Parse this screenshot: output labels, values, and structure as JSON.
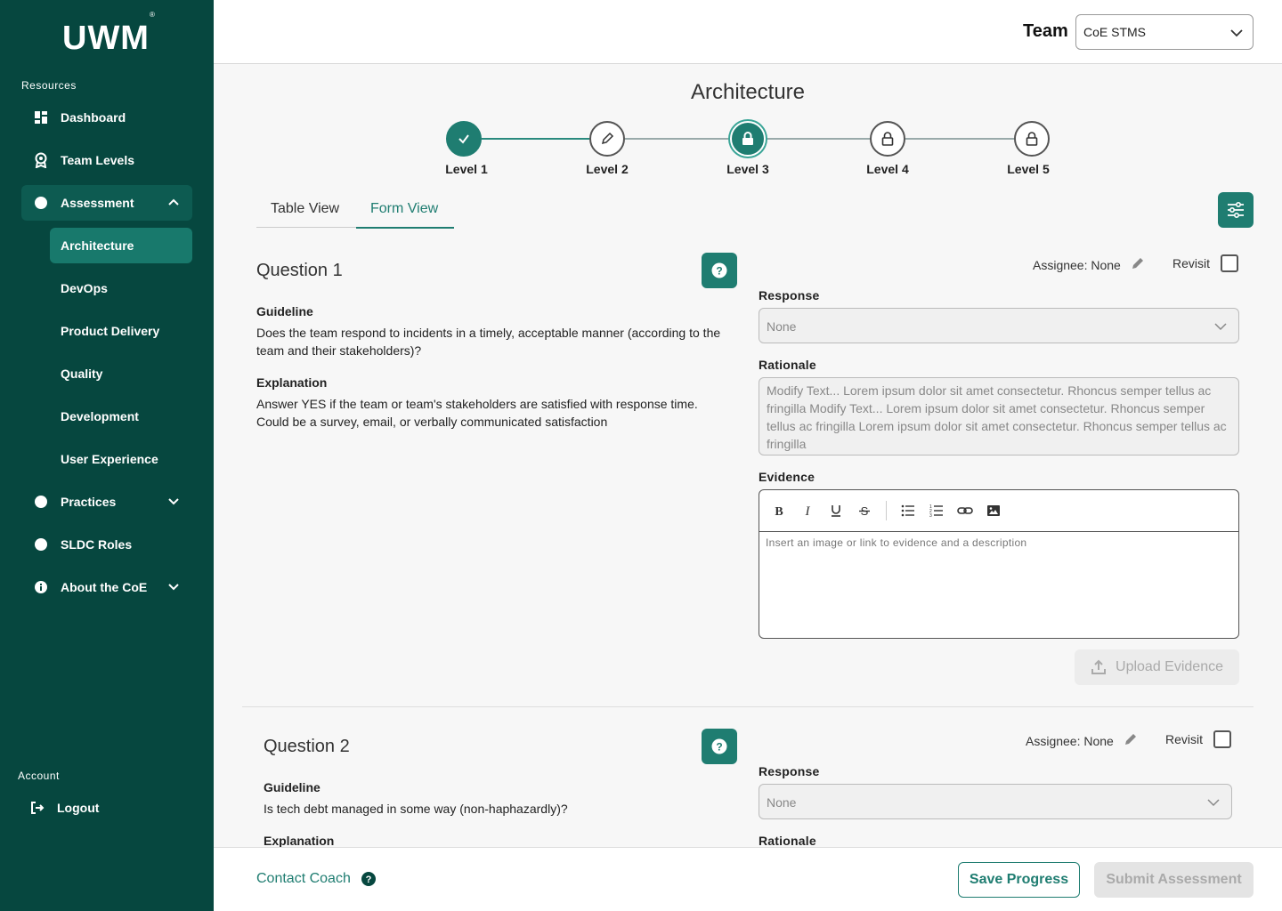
{
  "brand": {
    "logo_text": "UWM",
    "logo_mark": "®"
  },
  "sidebar": {
    "resources_label": "Resources",
    "items": {
      "dashboard": "Dashboard",
      "team_levels": "Team Levels",
      "assessment": "Assessment",
      "practices": "Practices",
      "sldc_roles": "SLDC Roles",
      "about": "About the CoE"
    },
    "assessment_sub": [
      "Architecture",
      "DevOps",
      "Product Delivery",
      "Quality",
      "Development",
      "User Experience"
    ],
    "account_label": "Account",
    "logout": "Logout"
  },
  "header": {
    "team_label": "Team",
    "team_value": "CoE STMS"
  },
  "page": {
    "title": "Architecture"
  },
  "stepper": {
    "levels": [
      "Level 1",
      "Level 2",
      "Level 3",
      "Level 4",
      "Level 5"
    ],
    "states": [
      "complete",
      "in-progress",
      "current-locked",
      "locked",
      "locked"
    ]
  },
  "tabs": {
    "table": "Table View",
    "form": "Form View",
    "active": "Form View"
  },
  "questions": [
    {
      "title": "Question 1",
      "guideline_label": "Guideline",
      "guideline": "Does the team respond to incidents in a timely, acceptable manner (according to the team and their stakeholders)?",
      "explanation_label": "Explanation",
      "explanation": "Answer YES if the team or team's stakeholders are satisfied with response time. Could be a survey, email, or verbally communicated satisfaction",
      "assignee": "Assignee: None",
      "revisit": "Revisit",
      "response_label": "Response",
      "response_value": "None",
      "rationale_label": "Rationale",
      "rationale": "Modify Text... Lorem ipsum dolor sit amet consectetur. Rhoncus semper tellus ac fringilla Modify Text... Lorem ipsum dolor sit amet consectetur. Rhoncus semper tellus ac fringilla Lorem ipsum dolor sit amet consectetur. Rhoncus semper tellus ac fringilla",
      "evidence_label": "Evidence",
      "evidence_placeholder": "Insert an image or link to evidence and a description",
      "upload_label": "Upload Evidence"
    },
    {
      "title": "Question 2",
      "guideline_label": "Guideline",
      "guideline": "Is tech debt managed in some way (non-haphazardly)?",
      "explanation_label": "Explanation",
      "assignee": "Assignee: None",
      "revisit": "Revisit",
      "response_label": "Response",
      "response_value": "None",
      "rationale_label": "Rationale"
    }
  ],
  "footer": {
    "contact": "Contact Coach",
    "save": "Save Progress",
    "submit": "Submit Assessment"
  },
  "colors": {
    "sidebar_bg": "#06473f",
    "accent": "#1f7d71",
    "active_nav": "#18796c"
  }
}
